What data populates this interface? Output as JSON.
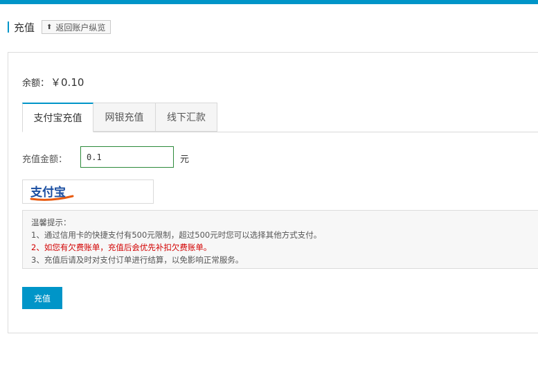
{
  "page": {
    "title": "充值",
    "back_label": "返回账户纵览"
  },
  "balance": {
    "label": "余额：",
    "value": "￥0.10"
  },
  "tabs": [
    {
      "label": "支付宝充值",
      "active": true
    },
    {
      "label": "网银充值",
      "active": false
    },
    {
      "label": "线下汇款",
      "active": false
    }
  ],
  "form": {
    "amount_label": "充值金额：",
    "amount_value": "0.1",
    "unit": "元"
  },
  "payment": {
    "logo_text": "支付宝",
    "logo_icon": "alipay-logo"
  },
  "tips": {
    "heading": "温馨提示：",
    "lines": [
      "1、通过信用卡的快捷支付有500元限制，超过500元时您可以选择其他方式支付。",
      "2、如您有欠费账单，充值后会优先补扣欠费账单。",
      "3、充值后请及时对支付订单进行结算，以免影响正常服务。"
    ]
  },
  "submit": {
    "label": "充值"
  },
  "colors": {
    "accent": "#0095c8",
    "input_border": "#2c8a3a",
    "warning": "#d20000"
  }
}
